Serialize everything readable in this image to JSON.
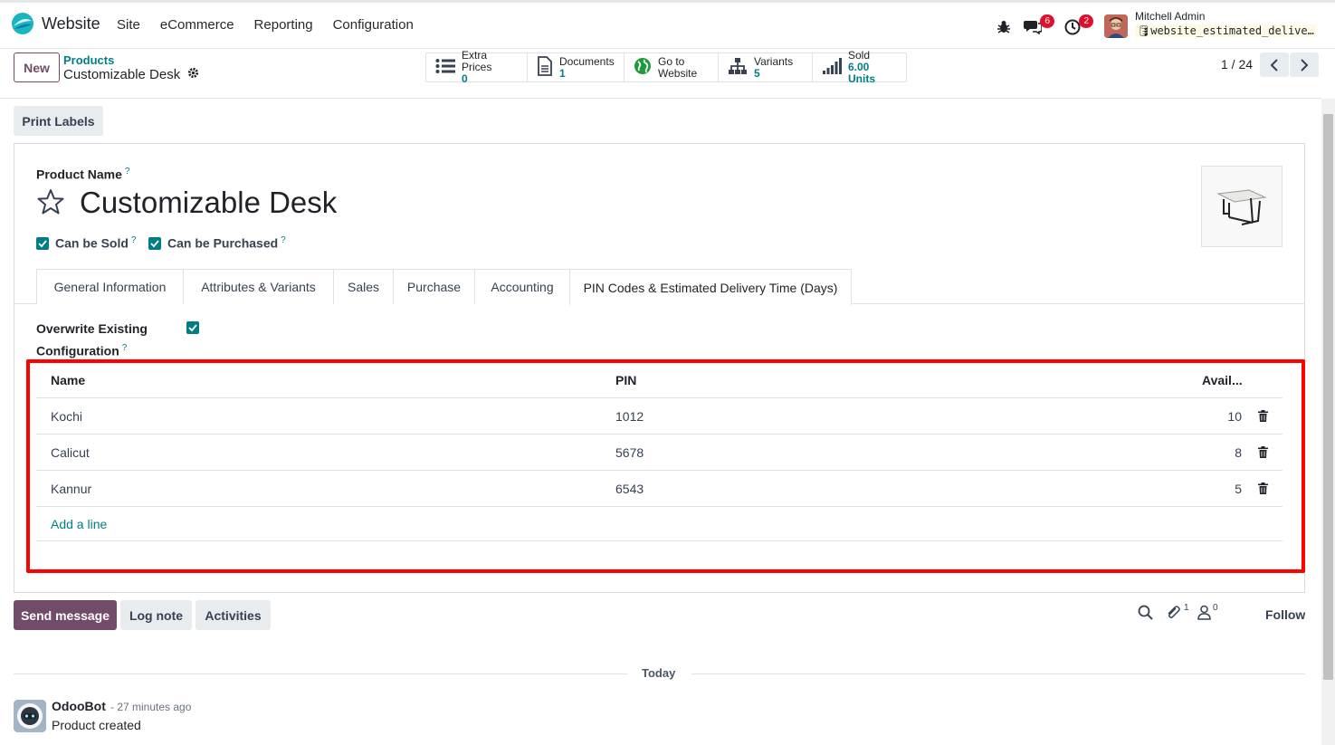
{
  "navbar": {
    "app_name": "Website",
    "menu": [
      "Site",
      "eCommerce",
      "Reporting",
      "Configuration"
    ],
    "messages_badge": "6",
    "activities_badge": "2",
    "user_name": "Mitchell Admin",
    "db_name": "website_estimated_delive…"
  },
  "control": {
    "new_label": "New",
    "breadcrumb_parent": "Products",
    "breadcrumb_current": "Customizable Desk",
    "smart_buttons": [
      {
        "label": "Extra Prices",
        "value": "0",
        "icon": "list-icon"
      },
      {
        "label": "Documents",
        "value": "1",
        "icon": "document-icon"
      },
      {
        "label": "Go to",
        "value": "Website",
        "icon": "globe-icon"
      },
      {
        "label": "Variants",
        "value": "5",
        "icon": "sitemap-icon"
      },
      {
        "label": "Sold",
        "value": "6.00 Units",
        "icon": "signal-icon"
      }
    ],
    "pager": "1 / 24"
  },
  "form": {
    "print_labels": "Print Labels",
    "product_name_label": "Product Name",
    "help_mark": "?",
    "product_name": "Customizable Desk",
    "can_be_sold": "Can be Sold",
    "can_be_purchased": "Can be Purchased",
    "tabs": [
      "General Information",
      "Attributes & Variants",
      "Sales",
      "Purchase",
      "Accounting",
      "PIN Codes & Estimated Delivery Time (Days)"
    ],
    "active_tab": "PIN Codes & Estimated Delivery Time (Days)",
    "overwrite_label_1": "Overwrite Existing",
    "overwrite_label_2": "Configuration",
    "table": {
      "headers": {
        "name": "Name",
        "pin": "PIN",
        "avail": "Avail..."
      },
      "rows": [
        {
          "name": "Kochi",
          "pin": "1012",
          "avail": "10"
        },
        {
          "name": "Calicut",
          "pin": "5678",
          "avail": "8"
        },
        {
          "name": "Kannur",
          "pin": "6543",
          "avail": "5"
        }
      ],
      "add_line": "Add a line"
    }
  },
  "chatter": {
    "send_message": "Send message",
    "log_note": "Log note",
    "activities": "Activities",
    "attachments_count": "1",
    "followers_count": "0",
    "follow": "Follow",
    "today": "Today",
    "author": "OdooBot",
    "time": "- 27 minutes ago",
    "message": "Product created"
  },
  "colors": {
    "primary": "#714b67",
    "link": "#017e84",
    "highlight": "#ff0000"
  }
}
